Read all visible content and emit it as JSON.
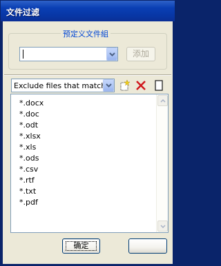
{
  "window": {
    "title": "文件过滤"
  },
  "group": {
    "legend": "预定义文件組",
    "combo_value": "",
    "add_button": "添加"
  },
  "filter": {
    "mode_label": "Exclude files that match:"
  },
  "list": {
    "items": [
      "*.docx",
      "*.doc",
      "*.odt",
      "*.xlsx",
      "*.xls",
      "*.ods",
      "*.csv",
      "*.rtf",
      "*.txt",
      "*.pdf"
    ]
  },
  "buttons": {
    "ok": "确定",
    "cancel": ""
  },
  "icons": {
    "dropdown": "chevron-down-icon",
    "new": "new-item-icon",
    "delete": "delete-x-icon",
    "edit": "edit-box-icon",
    "scroll_up": "arrow-up-icon",
    "scroll_down": "arrow-down-icon"
  },
  "colors": {
    "titlebar": "#0a3fb4",
    "accent_text": "#0046d5",
    "delete": "#d0171d"
  }
}
